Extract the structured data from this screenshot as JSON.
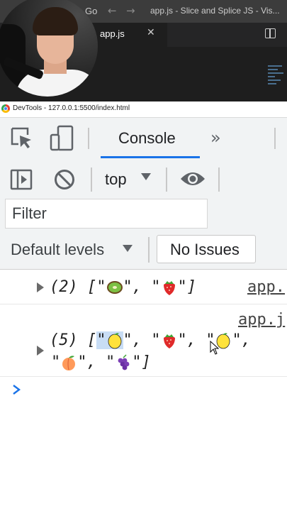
{
  "vscode": {
    "menu_go": "Go",
    "window_title": "app.js - Slice and Splice JS - Vis...",
    "tab_label": "app.js"
  },
  "devtools": {
    "window_title": "DevTools - 127.0.0.1:5500/index.html",
    "tabs": [
      {
        "label": "Console",
        "active": true
      }
    ],
    "more_tabs_glyph": "»",
    "context": "top",
    "filter_placeholder": "Filter",
    "levels_label": "Default levels",
    "issues_label": "No Issues"
  },
  "console": {
    "messages": [
      {
        "count": "(2)",
        "items": [
          "kiwi",
          "strawberry"
        ],
        "source": "app.",
        "expanded": false
      },
      {
        "count": "(5)",
        "items": [
          "lemon",
          "strawberry",
          "lemon",
          "peach",
          "grapes"
        ],
        "source": "app.j",
        "expanded": false,
        "highlighted_item_index": 0
      }
    ],
    "prompt_glyph": "›"
  },
  "colors": {
    "accent": "#1a73e8",
    "toolbar_bg": "#f1f3f4",
    "selection": "#c8ddf5"
  }
}
